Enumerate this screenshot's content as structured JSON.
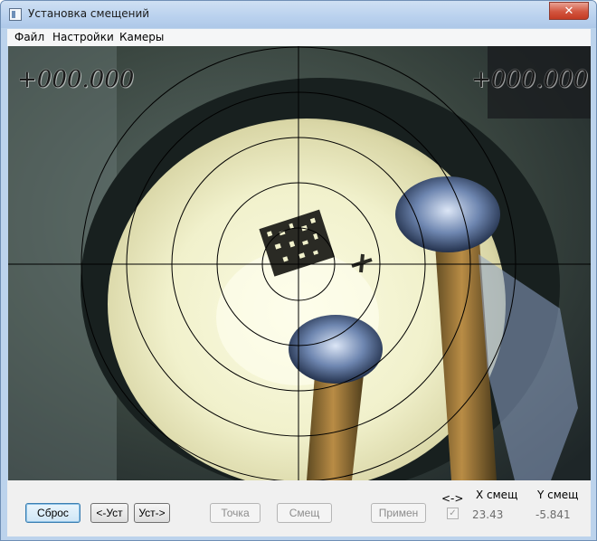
{
  "window": {
    "title": "Установка смещений",
    "controls": {
      "minimize": "—",
      "maximize": "□",
      "close": "✕"
    }
  },
  "menu": {
    "items": [
      "Файл",
      "Настройки",
      "Камеры"
    ]
  },
  "camera": {
    "overlay_left": "+000.000",
    "overlay_right": "+000.000"
  },
  "buttons": {
    "reset": "Сброс",
    "prev": "<-Уст",
    "next": "Уст->",
    "point": "Точка",
    "offset": "Смещ",
    "apply": "Примен"
  },
  "offsets": {
    "swap_label": "<->",
    "swap_checked": true,
    "x_label": "X смещ",
    "y_label": "Y смещ",
    "x_value": "23.43",
    "y_value": "-5.841"
  }
}
